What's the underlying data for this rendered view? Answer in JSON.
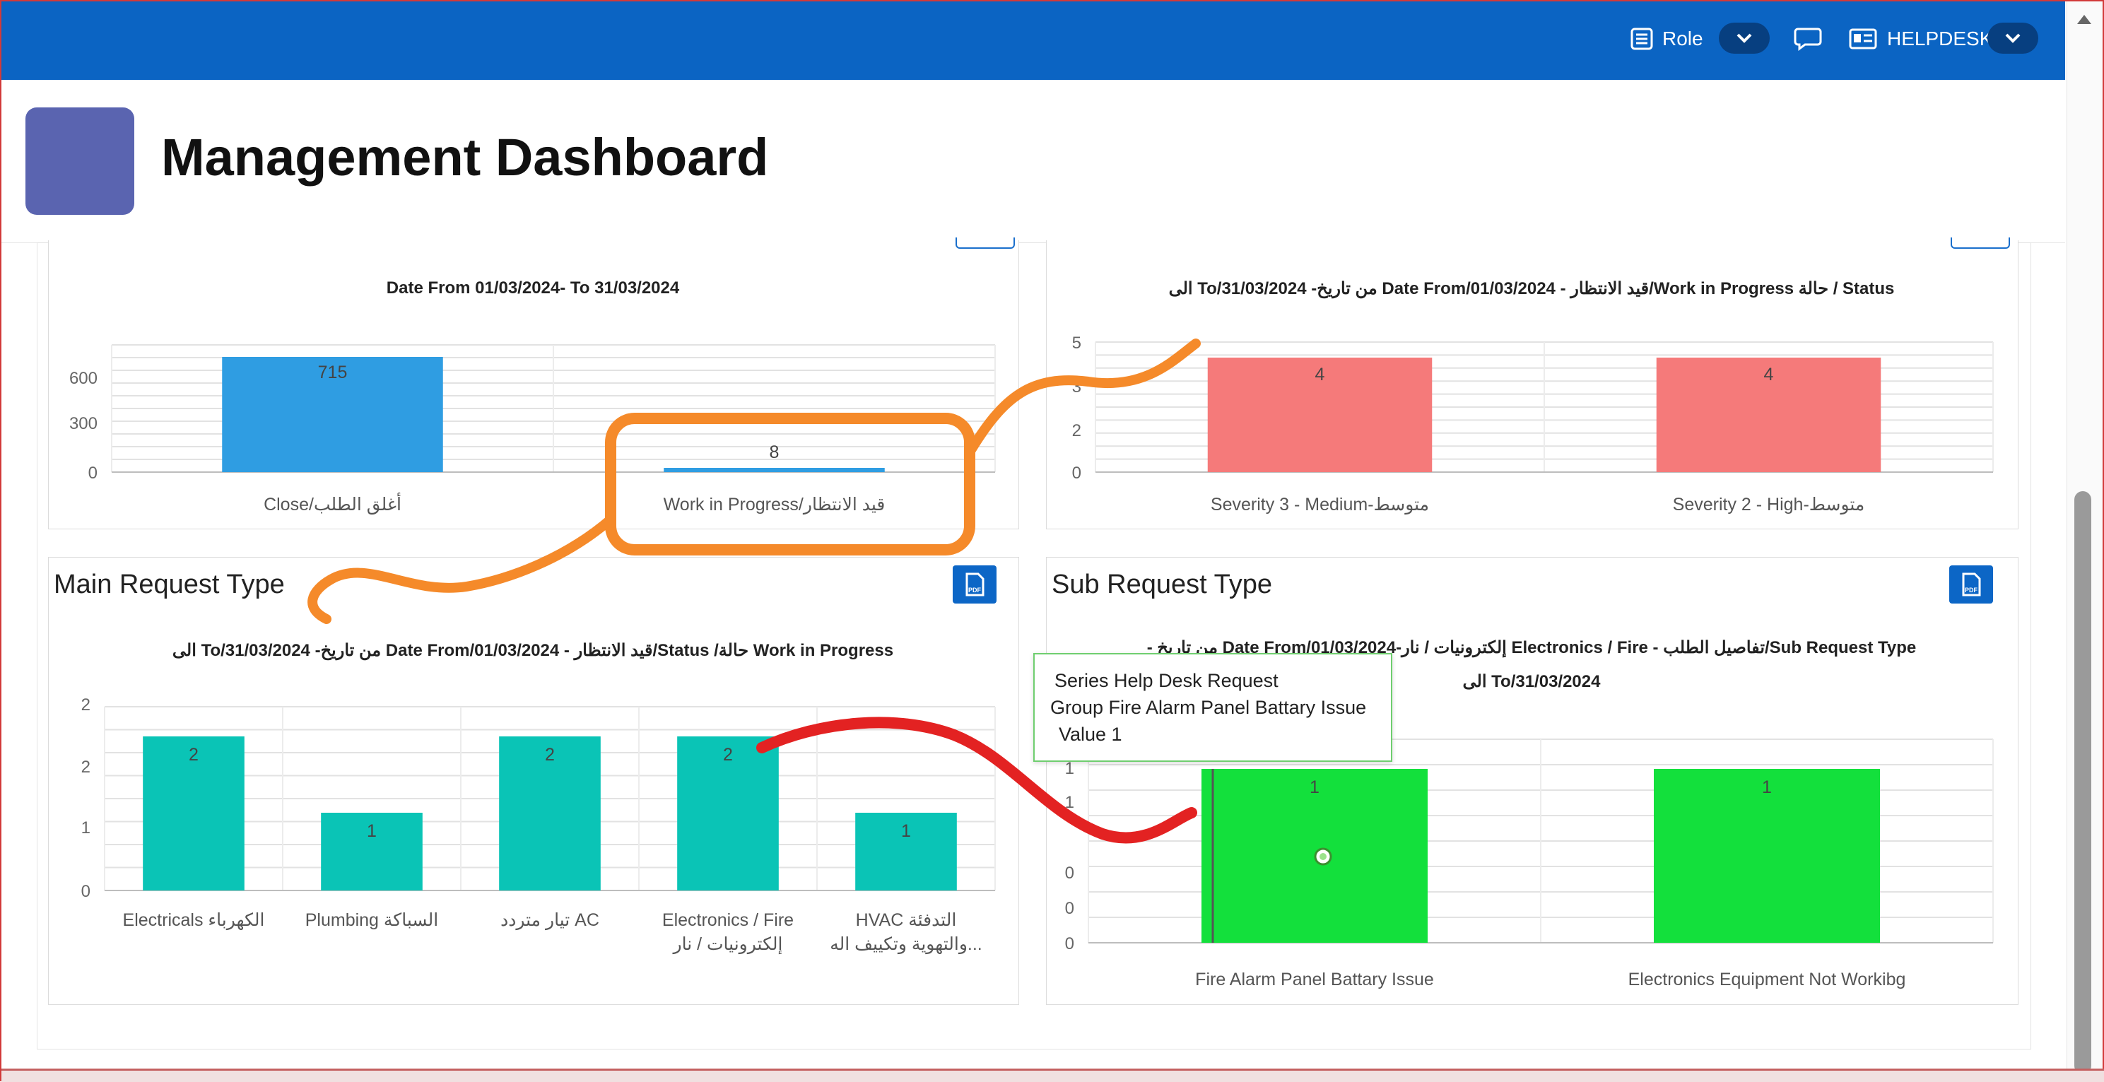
{
  "topbar": {
    "role_label": "Role",
    "user_label": "HELPDESK",
    "icons": [
      "list-icon",
      "chevron-down-icon",
      "chat-icon",
      "id-card-icon"
    ]
  },
  "header": {
    "title": "Management Dashboard"
  },
  "colors": {
    "topbar": "#0b64c3",
    "logo": "#5a64b0",
    "bar_blue": "#2f9de2",
    "bar_red": "#f57a7a",
    "bar_teal": "#0ac4b6",
    "bar_green": "#13e03c",
    "annotation_orange": "#f58a2a",
    "annotation_red": "#e32222"
  },
  "panel_closed": {
    "chart_title": "Date From 01/03/2024- To 31/03/2024"
  },
  "panel_severity": {
    "chart_title": "الى To/31/03/2024 -من تاريخ Date From/01/03/2024 - قيد الانتظار/Work in Progress حالة / Status"
  },
  "panel_main": {
    "title": "Main Request Type",
    "chart_title": "الى To/31/03/2024 -من تاريخ Date From/01/03/2024 - قيد الانتظار/Status /حالة Work in Progress"
  },
  "panel_sub": {
    "title": "Sub Request Type",
    "chart_title_line1": "- من تاريخ Date From/01/03/2024-إلكترونيات / نار Electronics / Fire - تفاصيل الطلب/Sub Request Type",
    "chart_title_line2": "الى To/31/03/2024"
  },
  "tooltip": {
    "series": "Series Help Desk Request",
    "group": "Group Fire Alarm Panel Battary Issue",
    "value": "Value 1"
  },
  "chart_data": [
    {
      "type": "bar",
      "title": "Date From 01/03/2024- To 31/03/2024",
      "categories": [
        "Close/أغلق الطلب",
        "Work in Progress/قيد الانتظار"
      ],
      "values": [
        715,
        8
      ],
      "yticks": [
        0,
        300,
        600
      ],
      "ylim": [
        0,
        800
      ],
      "grid": true
    },
    {
      "type": "bar",
      "title": "الى To/31/03/2024 -من تاريخ Date From/01/03/2024 - قيد الانتظار/Work in Progress حالة / Status",
      "categories": [
        "Severity 3 - Medium-متوسط",
        "Severity 2 - High-متوسط"
      ],
      "values": [
        4,
        4
      ],
      "yticks": [
        0,
        2,
        3,
        5
      ],
      "ylim": [
        0,
        5.2
      ],
      "grid": true
    },
    {
      "type": "bar",
      "title": "الى To/31/03/2024 -من تاريخ Date From/01/03/2024 - قيد الانتظار/Status /حالة Work in Progress",
      "categories": [
        "Electricals الكهرباء",
        "Plumbing السباكة",
        "تيار متردد AC",
        "Electronics / Fire|إلكترونيات / نار",
        "HVAC التدفئة|والتهوية وتكييف اله..."
      ],
      "values": [
        2,
        1,
        2,
        2,
        1
      ],
      "yticks": [
        0,
        1,
        2,
        2
      ],
      "ylim": [
        0,
        2.4
      ],
      "grid": true
    },
    {
      "type": "bar",
      "title": "- من تاريخ Date From/01/03/2024-إلكترونيات / نار Electronics / Fire - تفاصيل الطلب/Sub Request Type الى To/31/03/2024",
      "series": [
        {
          "name": "Help Desk Request",
          "values": [
            1,
            1
          ]
        }
      ],
      "categories": [
        "Fire Alarm Panel Battary Issue",
        "Electronics Equipment Not Workibg"
      ],
      "yticks": [
        0,
        0,
        0,
        1,
        1
      ],
      "ylim": [
        0,
        1.2
      ],
      "grid": true
    }
  ]
}
